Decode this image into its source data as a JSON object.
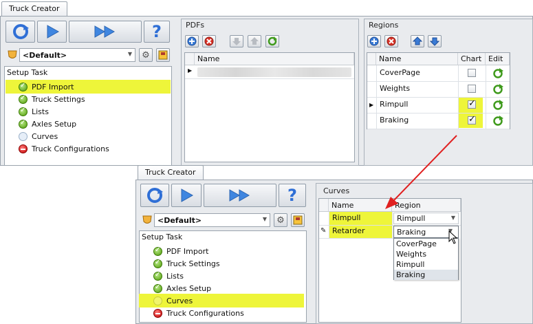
{
  "top_window": {
    "tab_title": "Truck Creator",
    "profile_combo": "<Default>",
    "setup_task_header": "Setup Task",
    "tasks": [
      {
        "label": "PDF Import",
        "state": "done",
        "highlighted": true
      },
      {
        "label": "Truck Settings",
        "state": "done",
        "highlighted": false
      },
      {
        "label": "Lists",
        "state": "done",
        "highlighted": false
      },
      {
        "label": "Axles Setup",
        "state": "done",
        "highlighted": false
      },
      {
        "label": "Curves",
        "state": "pending",
        "highlighted": false
      },
      {
        "label": "Truck Configurations",
        "state": "error",
        "highlighted": false
      }
    ],
    "pdfs_panel": {
      "title": "PDFs",
      "column_name": "Name"
    },
    "regions_panel": {
      "title": "Regions",
      "columns": {
        "name": "Name",
        "chart": "Chart",
        "edit": "Edit"
      },
      "rows": [
        {
          "name": "CoverPage",
          "chart": false
        },
        {
          "name": "Weights",
          "chart": false
        },
        {
          "name": "Rimpull",
          "chart": true
        },
        {
          "name": "Braking",
          "chart": true
        }
      ]
    }
  },
  "bottom_window": {
    "tab_title": "Truck Creator",
    "profile_combo": "<Default>",
    "setup_task_header": "Setup Task",
    "tasks": [
      {
        "label": "PDF Import",
        "state": "done",
        "highlighted": false
      },
      {
        "label": "Truck Settings",
        "state": "done",
        "highlighted": false
      },
      {
        "label": "Lists",
        "state": "done",
        "highlighted": false
      },
      {
        "label": "Axles Setup",
        "state": "done",
        "highlighted": false
      },
      {
        "label": "Curves",
        "state": "pending",
        "highlighted": true
      },
      {
        "label": "Truck Configurations",
        "state": "error",
        "highlighted": false
      }
    ],
    "curves_panel": {
      "title": "Curves",
      "columns": {
        "name": "Name",
        "region": "Region"
      },
      "rows": [
        {
          "name": "Rimpull",
          "region": "Rimpull"
        },
        {
          "name": "Retarder",
          "region": "Braking"
        }
      ],
      "dropdown_options": [
        "CoverPage",
        "Weights",
        "Rimpull",
        "Braking"
      ]
    }
  },
  "colors": {
    "highlight": "#eef53a",
    "arrow": "#e02020",
    "accent_blue": "#2f6fd6"
  }
}
